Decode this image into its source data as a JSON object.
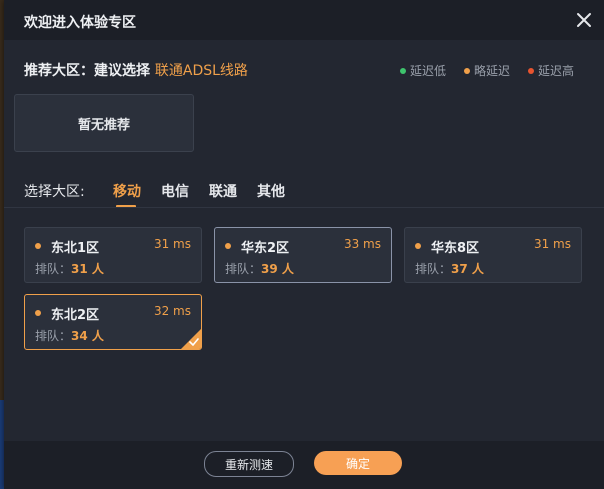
{
  "window": {
    "title": "欢迎进入体验专区"
  },
  "recommend": {
    "prefix": "推荐大区：建议选择",
    "highlight": "联通ADSL线路",
    "none_label": "暂无推荐"
  },
  "legend": [
    {
      "label": "延迟低",
      "color": "#3ec46d"
    },
    {
      "label": "略延迟",
      "color": "#f0a04a"
    },
    {
      "label": "延迟高",
      "color": "#e8542f"
    }
  ],
  "region": {
    "label": "选择大区:",
    "tabs": [
      "移动",
      "电信",
      "联通",
      "其他"
    ],
    "active_tab": "移动"
  },
  "servers": [
    {
      "name": "东北1区",
      "ping": "31 ms",
      "queue_label": "排队：",
      "queue": "31 人"
    },
    {
      "name": "华东2区",
      "ping": "33 ms",
      "queue_label": "排队：",
      "queue": "39 人"
    },
    {
      "name": "华东8区",
      "ping": "31 ms",
      "queue_label": "排队：",
      "queue": "37 人"
    },
    {
      "name": "东北2区",
      "ping": "32 ms",
      "queue_label": "排队：",
      "queue": "34 人"
    }
  ],
  "selected_server": "东北2区",
  "footer": {
    "retest_label": "重新测速",
    "ok_label": "确定"
  },
  "colors": {
    "accent": "#f0a04a",
    "dialog_bg": "#232731"
  }
}
